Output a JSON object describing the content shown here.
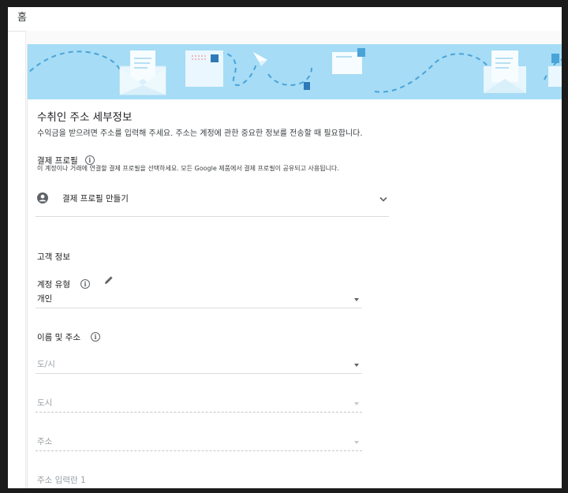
{
  "topbar": {
    "title": "홈"
  },
  "address": {
    "title": "수취인 주소 세부정보",
    "description": "수익금을 받으려면 주소를 입력해 주세요. 주소는 계정에 관한 중요한 정보를 전송할 때 필요합니다."
  },
  "payment_profile": {
    "label": "결제 프로필",
    "info_glyph": "i",
    "description": "이 계정이나 거래에 연결할 결제 프로필을 선택하세요. 모든 Google 제품에서 결제 프로필이 공유되고 사용됩니다.",
    "selected": "결제 프로필 만들기"
  },
  "customer": {
    "title": "고객 정보",
    "account_type_label": "계정 유형",
    "account_type_value": "개인",
    "name_address_label": "이름 및 주소",
    "province_placeholder": "도/시",
    "city_placeholder": "도시",
    "address_placeholder": "주소",
    "address_line1_placeholder": "주소 입력란 1"
  }
}
